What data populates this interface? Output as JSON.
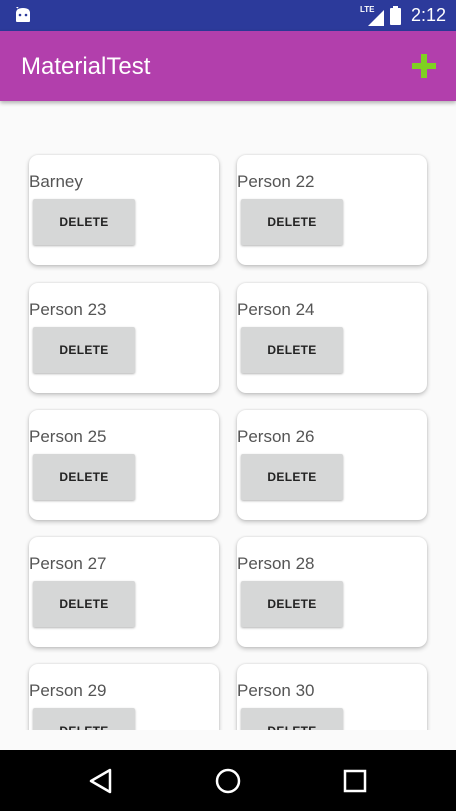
{
  "status_bar": {
    "network_label": "LTE",
    "time": "2:12",
    "icons": [
      "android-icon",
      "lte-signal-icon",
      "battery-icon"
    ]
  },
  "app_bar": {
    "title": "MaterialTest",
    "add_icon": "plus-icon",
    "colors": {
      "app_bar": "#b23fac",
      "status_bar": "#2c3a9b",
      "add_icon": "#7fd021"
    }
  },
  "list": {
    "delete_label": "DELETE",
    "items": [
      {
        "name": "Barney"
      },
      {
        "name": "Person 22"
      },
      {
        "name": "Person 23"
      },
      {
        "name": "Person 24"
      },
      {
        "name": "Person 25"
      },
      {
        "name": "Person 26"
      },
      {
        "name": "Person 27"
      },
      {
        "name": "Person 28"
      },
      {
        "name": "Person 29"
      },
      {
        "name": "Person 30"
      }
    ]
  },
  "nav_bar": {
    "icons": [
      "back-icon",
      "home-icon",
      "recents-icon"
    ]
  }
}
